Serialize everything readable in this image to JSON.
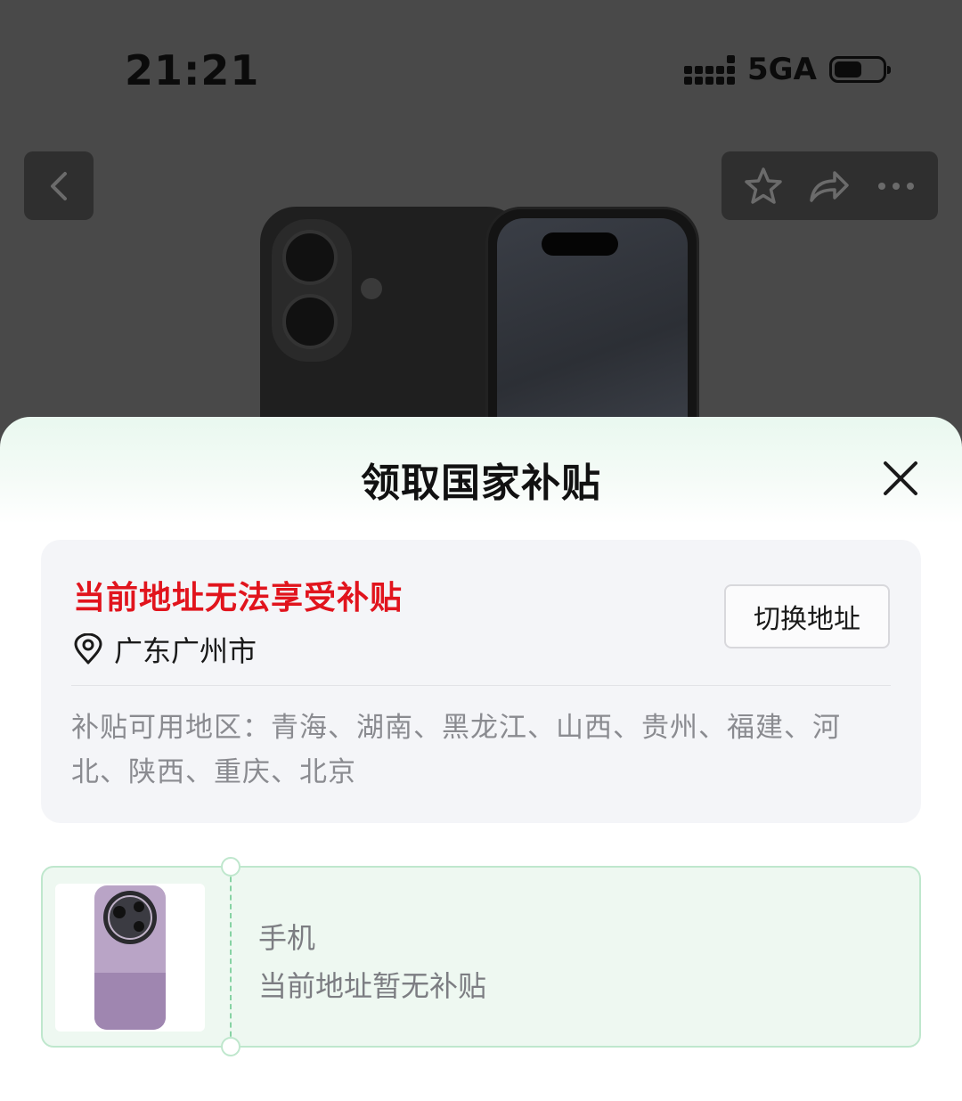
{
  "status_bar": {
    "time": "21:21",
    "network": "5GA"
  },
  "icons": {
    "back": "chevron-left-icon",
    "favorite": "star-icon",
    "share": "share-icon",
    "more": "more-dots-icon",
    "close": "close-icon",
    "location": "location-pin-icon"
  },
  "sheet": {
    "title": "领取国家补贴",
    "address_card": {
      "warning": "当前地址无法享受补贴",
      "current_location": "广东广州市",
      "switch_button": "切换地址",
      "regions_text": "补贴可用地区：青海、湖南、黑龙江、山西、贵州、福建、河北、陕西、重庆、北京"
    },
    "coupon": {
      "category": "手机",
      "message": "当前地址暂无补贴"
    }
  },
  "colors": {
    "warning_red": "#e1141d",
    "coupon_bg": "#eef8f1",
    "coupon_border": "#bfe7cd",
    "overlay_bg": "#494949"
  }
}
